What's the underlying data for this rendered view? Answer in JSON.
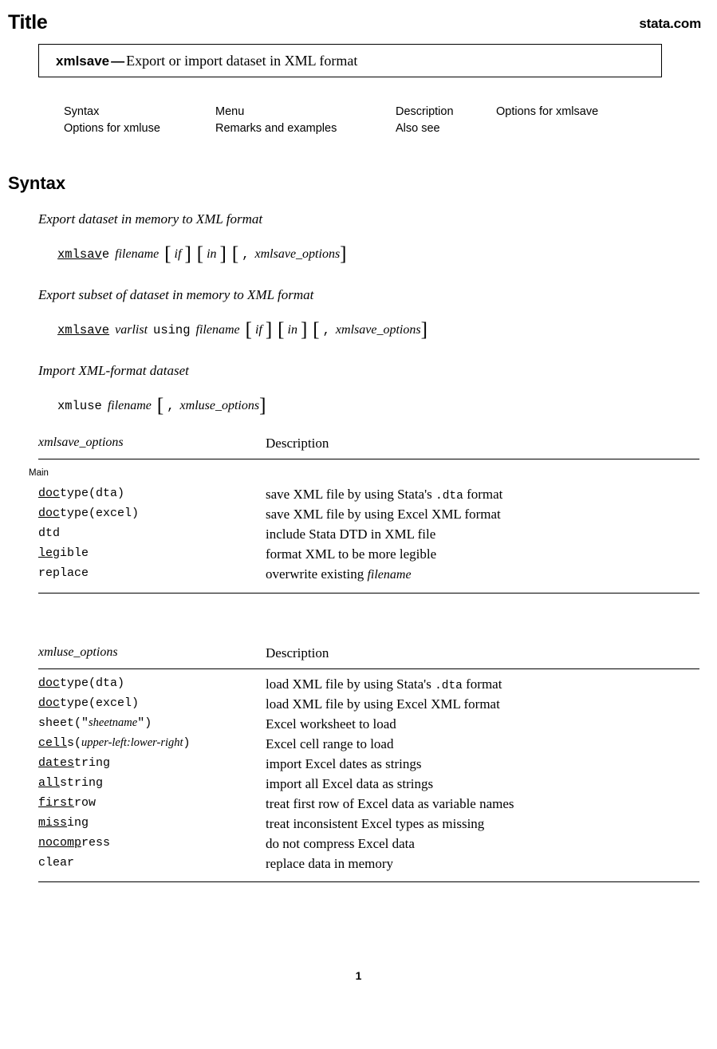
{
  "header": {
    "title": "Title",
    "site": "stata.com"
  },
  "title_box": {
    "command": "xmlsave",
    "dash": "—",
    "description": "Export or import dataset in XML format"
  },
  "nav": {
    "row1": [
      "Syntax",
      "Menu",
      "Description",
      "Options for xmlsave"
    ],
    "row2": [
      "Options for xmluse",
      "Remarks and examples",
      "Also see",
      ""
    ]
  },
  "section": {
    "heading": "Syntax"
  },
  "syntax": [
    {
      "caption": "Export dataset in memory to XML format",
      "cmd_underlined": "xmlsav",
      "cmd_rest": "e",
      "parts": [
        "filename"
      ],
      "opt_bracket": "xmlsave_options",
      "if_label": "if",
      "in_label": "in",
      "comma": ","
    },
    {
      "caption": "Export subset of dataset in memory to XML format",
      "cmd_underlined": "xmlsave",
      "cmd_rest": "",
      "varlist": "varlist",
      "using": "using",
      "filename": "filename",
      "opt_bracket": "xmlsave_options",
      "if_label": "if",
      "in_label": "in",
      "comma": ","
    },
    {
      "caption": "Import XML-format dataset",
      "cmd": "xmluse",
      "filename": "filename",
      "opt_bracket": "xmluse_options",
      "comma": ","
    }
  ],
  "tables": [
    {
      "col_options": "xmlsave_options",
      "col_description": "Description",
      "subhead": "Main",
      "rows": [
        {
          "underlined": "doc",
          "rest": "type(dta)",
          "desc": "save XML file by using Stata's ",
          "desc_mono": ".dta",
          "desc_tail": " format"
        },
        {
          "underlined": "doc",
          "rest": "type(excel)",
          "desc": "save XML file by using Excel XML format"
        },
        {
          "underlined": "",
          "rest": "dtd",
          "desc": "include Stata DTD in XML file"
        },
        {
          "underlined": "leg",
          "rest": "ible",
          "desc": "format XML to be more legible"
        },
        {
          "underlined": "",
          "rest": "replace",
          "desc": "overwrite existing ",
          "desc_ital": "filename"
        }
      ]
    },
    {
      "col_options": "xmluse_options",
      "col_description": "Description",
      "subhead": "",
      "rows": [
        {
          "underlined": "doc",
          "rest": "type(dta)",
          "desc": "load XML file by using Stata's ",
          "desc_mono": ".dta",
          "desc_tail": " format"
        },
        {
          "underlined": "doc",
          "rest": "type(excel)",
          "desc": "load XML file by using Excel XML format"
        },
        {
          "underlined": "",
          "rest": "sheet(\"",
          "arg": "sheetname",
          "rest2": "\")",
          "desc": "Excel worksheet to load"
        },
        {
          "underlined": "cell",
          "rest": "s(",
          "arg": "upper-left:lower-right",
          "rest2": ")",
          "desc": "Excel cell range to load"
        },
        {
          "underlined": "dates",
          "rest": "tring",
          "desc": "import Excel dates as strings"
        },
        {
          "underlined": "all",
          "rest": "string",
          "desc": "import all Excel data as strings"
        },
        {
          "underlined": "first",
          "rest": "row",
          "desc": "treat first row of Excel data as variable names"
        },
        {
          "underlined": "miss",
          "rest": "ing",
          "desc": "treat inconsistent Excel types as missing"
        },
        {
          "underlined": "nocomp",
          "rest": "ress",
          "desc": "do not compress Excel data"
        },
        {
          "underlined": "",
          "rest": "clear",
          "desc": "replace data in memory"
        }
      ]
    }
  ],
  "footer": {
    "page_number": "1"
  }
}
